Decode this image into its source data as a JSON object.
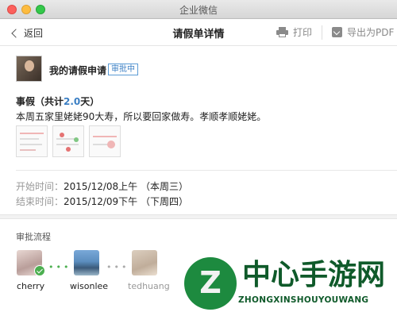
{
  "window": {
    "title": "企业微信"
  },
  "nav": {
    "back_label": "返回",
    "title": "请假单详情",
    "print_label": "打印",
    "export_label": "导出为PDF"
  },
  "request": {
    "title": "我的请假申请",
    "status": "审批中",
    "type_prefix": "事假（共计",
    "days": "2.0",
    "type_suffix": "天）",
    "reason": "本周五家里姥姥90大寿，所以要回家做寿。孝顺孝顺姥姥。",
    "start_label": "开始时间：",
    "start_value": "2015/12/08上午  （本周三）",
    "end_label": "结束时间：",
    "end_value": "2015/12/09下午  （下周四）"
  },
  "attachments": [
    {
      "name": "image-1"
    },
    {
      "name": "image-2"
    },
    {
      "name": "image-3"
    }
  ],
  "approval": {
    "section_title": "审批流程",
    "approvers": [
      {
        "name": "cherry",
        "state": "approved"
      },
      {
        "name": "wisonlee",
        "state": "pending"
      },
      {
        "name": "tedhuang",
        "state": "waiting"
      }
    ]
  },
  "watermark": {
    "title": "中心手游网",
    "subtitle": "ZHONGXINSHOUYOUWANG"
  },
  "colors": {
    "accent": "#3b7fc4",
    "approved": "#4caf50",
    "watermark": "#0f5a2a"
  }
}
